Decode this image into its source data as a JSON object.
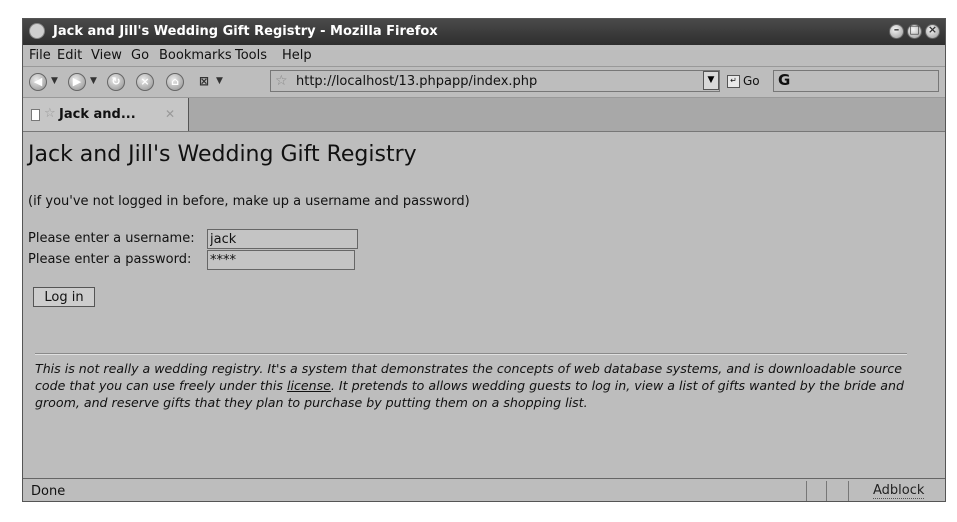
{
  "window": {
    "title": "Jack and Jill's Wedding Gift Registry - Mozilla Firefox"
  },
  "menu": {
    "items": [
      "File",
      "Edit",
      "View",
      "Go",
      "Bookmarks",
      "Tools",
      "Help"
    ]
  },
  "toolbar": {
    "url": "http://localhost/13.phpapp/index.php",
    "go_label": "Go",
    "search_prefix": "G"
  },
  "tab": {
    "label": "Jack and..."
  },
  "page": {
    "heading": "Jack and Jill's Wedding Gift Registry",
    "note": "(if you've not logged in before, make up a username and password)",
    "username_label": "Please enter a username:",
    "username_value": "jack",
    "password_label": "Please enter a password:",
    "password_value": "****",
    "login_button": "Log in",
    "footer_part1": "This is not really a wedding registry. It's a system that demonstrates the concepts of web database systems, and is downloadable source code that you can use freely under this ",
    "footer_link": "license",
    "footer_part2": ". It pretends to allows wedding guests to log in, view a list of gifts wanted by the bride and groom, and reserve gifts that they plan to purchase by putting them on a shopping list."
  },
  "status": {
    "text": "Done",
    "adblock": "Adblock"
  }
}
